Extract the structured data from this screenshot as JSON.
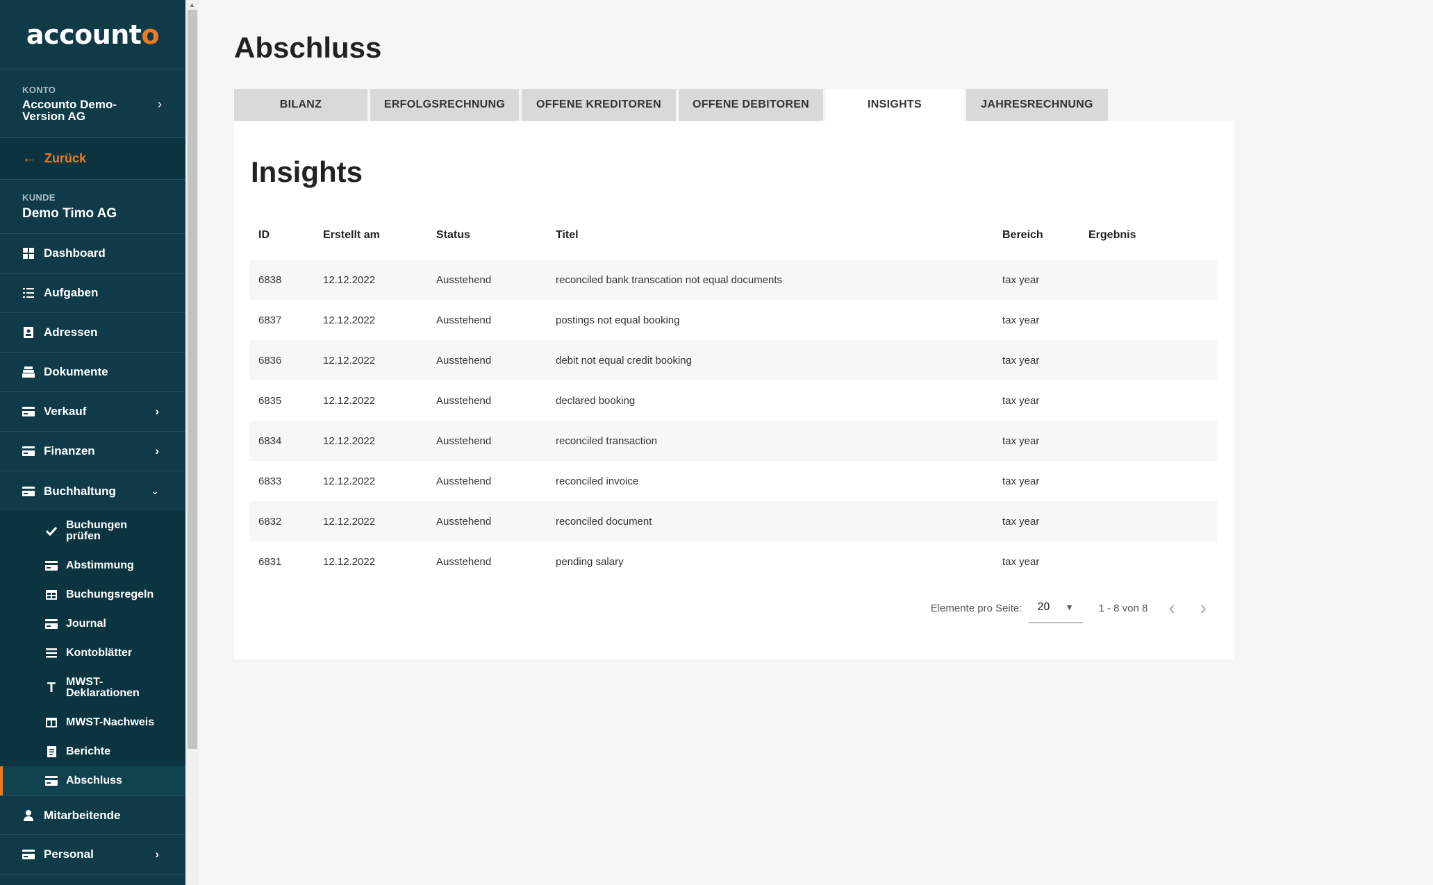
{
  "app": {
    "logo_main": "account",
    "logo_accent": "o"
  },
  "sidebar": {
    "konto_caption": "KONTO",
    "konto_name": "Accounto Demo-Version AG",
    "back_label": "Zurück",
    "kunde_caption": "KUNDE",
    "kunde_name": "Demo Timo AG",
    "items": [
      {
        "label": "Dashboard",
        "icon": "dashboard-icon"
      },
      {
        "label": "Aufgaben",
        "icon": "list-icon"
      },
      {
        "label": "Adressen",
        "icon": "contact-icon"
      },
      {
        "label": "Dokumente",
        "icon": "documents-icon"
      },
      {
        "label": "Verkauf",
        "icon": "card-icon",
        "chevron": true
      },
      {
        "label": "Finanzen",
        "icon": "card-icon",
        "chevron": true
      },
      {
        "label": "Buchhaltung",
        "icon": "card-icon",
        "chevron_down": true
      }
    ],
    "sub_items": [
      {
        "label": "Buchungen prüfen",
        "icon": "check-icon"
      },
      {
        "label": "Abstimmung",
        "icon": "card-icon"
      },
      {
        "label": "Buchungsregeln",
        "icon": "table-icon"
      },
      {
        "label": "Journal",
        "icon": "card-icon"
      },
      {
        "label": "Kontoblätter",
        "icon": "lines-icon"
      },
      {
        "label": "MWST-Deklarationen",
        "icon": "text-icon"
      },
      {
        "label": "MWST-Nachweis",
        "icon": "columns-icon"
      },
      {
        "label": "Berichte",
        "icon": "report-icon"
      },
      {
        "label": "Abschluss",
        "icon": "card-icon",
        "active": true
      }
    ],
    "bottom_items": [
      {
        "label": "Mitarbeitende",
        "icon": "person-icon"
      },
      {
        "label": "Personal",
        "icon": "card-icon",
        "chevron": true
      }
    ]
  },
  "main": {
    "title": "Abschluss",
    "tabs": [
      {
        "label": "BILANZ",
        "active": false
      },
      {
        "label": "ERFOLGSRECHNUNG",
        "active": false
      },
      {
        "label": "OFFENE KREDITOREN",
        "active": false
      },
      {
        "label": "OFFENE DEBITOREN",
        "active": false
      },
      {
        "label": "INSIGHTS",
        "active": true
      },
      {
        "label": "JAHRESRECHNUNG",
        "active": false
      }
    ],
    "card_title": "Insights",
    "table": {
      "headers": {
        "id": "ID",
        "created": "Erstellt am",
        "status": "Status",
        "title": "Titel",
        "area": "Bereich",
        "result": "Ergebnis"
      },
      "rows": [
        {
          "id": "6838",
          "created": "12.12.2022",
          "status": "Ausstehend",
          "title": "reconciled bank transcation not equal documents",
          "area": "tax year",
          "result": ""
        },
        {
          "id": "6837",
          "created": "12.12.2022",
          "status": "Ausstehend",
          "title": "postings not equal booking",
          "area": "tax year",
          "result": ""
        },
        {
          "id": "6836",
          "created": "12.12.2022",
          "status": "Ausstehend",
          "title": "debit not equal credit booking",
          "area": "tax year",
          "result": ""
        },
        {
          "id": "6835",
          "created": "12.12.2022",
          "status": "Ausstehend",
          "title": "declared booking",
          "area": "tax year",
          "result": ""
        },
        {
          "id": "6834",
          "created": "12.12.2022",
          "status": "Ausstehend",
          "title": "reconciled transaction",
          "area": "tax year",
          "result": ""
        },
        {
          "id": "6833",
          "created": "12.12.2022",
          "status": "Ausstehend",
          "title": "reconciled invoice",
          "area": "tax year",
          "result": ""
        },
        {
          "id": "6832",
          "created": "12.12.2022",
          "status": "Ausstehend",
          "title": "reconciled document",
          "area": "tax year",
          "result": ""
        },
        {
          "id": "6831",
          "created": "12.12.2022",
          "status": "Ausstehend",
          "title": "pending salary",
          "area": "tax year",
          "result": ""
        }
      ]
    },
    "pager": {
      "per_page_label": "Elemente pro Seite:",
      "per_page_value": "20",
      "range": "1 - 8 von 8"
    }
  },
  "colors": {
    "sidebar_bg": "#0f3a48",
    "accent": "#ee7a22",
    "tab_inactive": "#d9d9d9"
  }
}
